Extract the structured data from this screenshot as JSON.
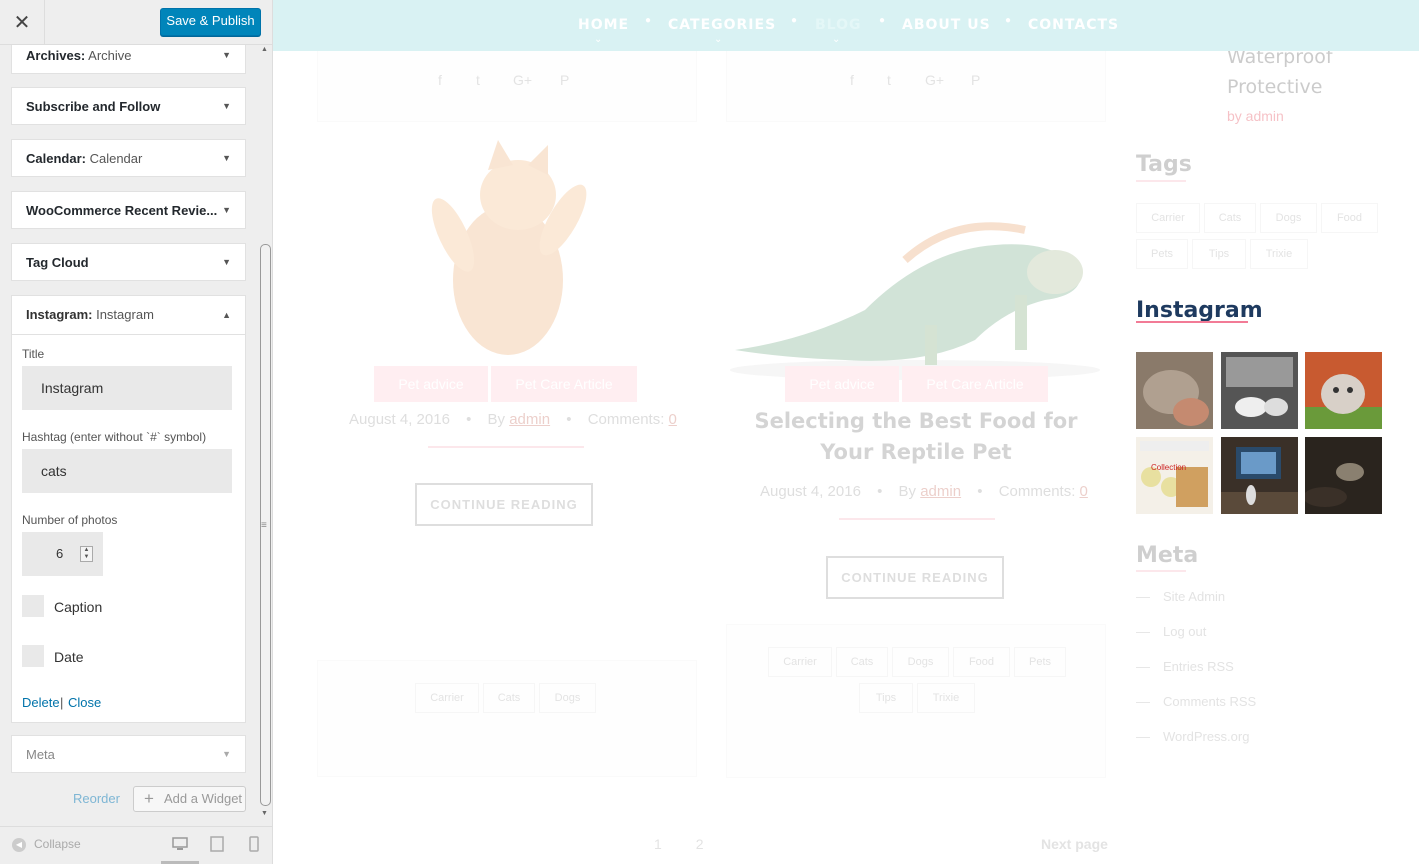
{
  "sidebar": {
    "close_icon": "close-icon",
    "save_label": "Save & Publish",
    "widgets": [
      {
        "bold": "Archives:",
        "sub": "Archive"
      },
      {
        "bold": "Subscribe and Follow",
        "sub": ""
      },
      {
        "bold": "Calendar:",
        "sub": "Calendar"
      },
      {
        "bold": "WooCommerce Recent Revie...",
        "sub": ""
      },
      {
        "bold": "Tag Cloud",
        "sub": ""
      }
    ],
    "instagram_widget": {
      "bold": "Instagram:",
      "sub": "Instagram",
      "title_label": "Title",
      "title_value": "Instagram",
      "hashtag_label": "Hashtag (enter without `#` symbol)",
      "hashtag_value": "cats",
      "photos_label": "Number of photos",
      "photos_value": "6",
      "caption_label": "Caption",
      "date_label": "Date",
      "delete_label": "Delete",
      "separator": "|",
      "close_label": "Close"
    },
    "meta_widget": "Meta",
    "reorder_label": "Reorder",
    "add_widget_label": "Add a Widget",
    "collapse_label": "Collapse"
  },
  "preview": {
    "nav": [
      "HOME",
      "CATEGORIES",
      "BLOG",
      "ABOUT US",
      "CONTACTS"
    ],
    "posts": [
      {
        "badges": [
          "Pet advice",
          "Pet Care Article"
        ],
        "date": "August 4, 2016",
        "by": "By",
        "author": "admin",
        "comments_label": "Comments:",
        "comments": "0",
        "button": "CONTINUE READING",
        "tags": [
          "Carrier",
          "Cats",
          "Dogs"
        ]
      },
      {
        "title": "Selecting the Best Food for Your Reptile Pet",
        "badges": [
          "Pet advice",
          "Pet Care Article"
        ],
        "date": "August 4, 2016",
        "by": "By",
        "author": "admin",
        "comments_label": "Comments:",
        "comments": "0",
        "button": "CONTINUE READING",
        "tags": [
          "Carrier",
          "Cats",
          "Dogs",
          "Food",
          "Pets",
          "Tips",
          "Trixie"
        ]
      }
    ],
    "side": {
      "product_title": "Waterproof Protective",
      "product_by": "by admin",
      "tags_title": "Tags",
      "tags": [
        "Carrier",
        "Cats",
        "Dogs",
        "Food",
        "Pets",
        "Tips",
        "Trixie"
      ],
      "instagram_title": "Instagram",
      "meta_title": "Meta",
      "meta_links": [
        "Site Admin",
        "Log out",
        "Entries RSS",
        "Comments RSS",
        "WordPress.org"
      ]
    },
    "pagination": {
      "page1": "1",
      "page2": "2",
      "next": "Next page"
    }
  },
  "colors": {
    "accent": "#0085ba",
    "nav_bg": "#d9f2f3",
    "badge": "#ffc0cb",
    "instagram_heading": "#1e3a5f"
  }
}
